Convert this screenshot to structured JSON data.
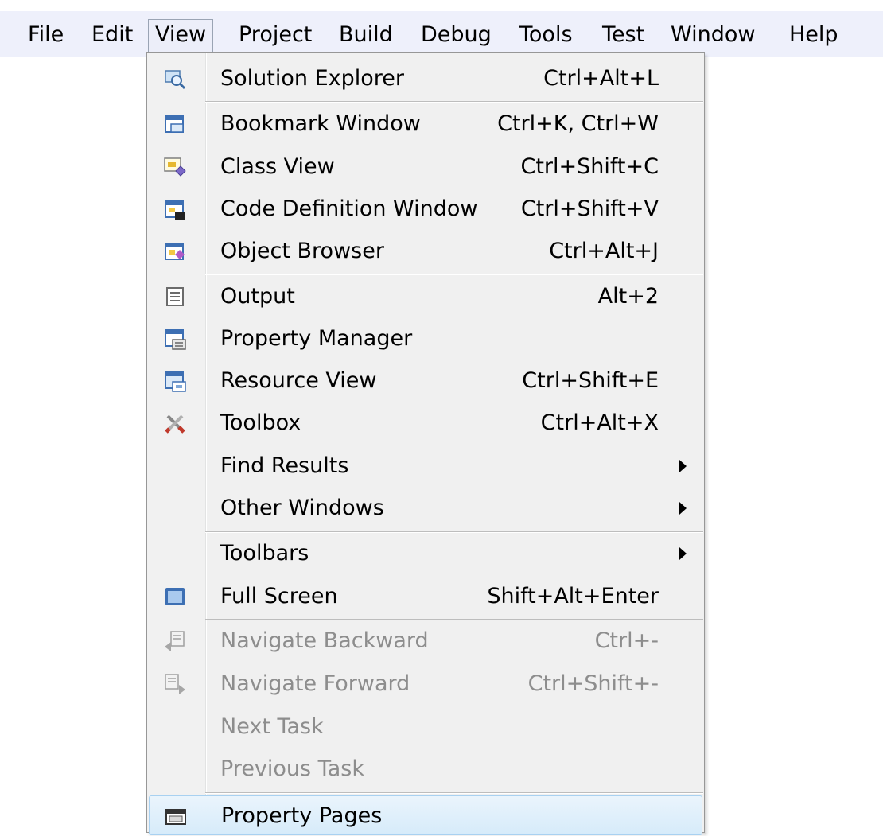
{
  "menubar": {
    "items": [
      {
        "label": "File"
      },
      {
        "label": "Edit"
      },
      {
        "label": "View"
      },
      {
        "label": "Project"
      },
      {
        "label": "Build"
      },
      {
        "label": "Debug"
      },
      {
        "label": "Tools"
      },
      {
        "label": "Test"
      },
      {
        "label": "Window"
      },
      {
        "label": "Help"
      }
    ]
  },
  "view_menu": {
    "items": [
      {
        "label": "Solution Explorer",
        "shortcut": "Ctrl+Alt+L",
        "icon": "solution-explorer-icon"
      },
      {
        "label": "Bookmark Window",
        "shortcut": "Ctrl+K, Ctrl+W",
        "icon": "bookmark-window-icon"
      },
      {
        "label": "Class View",
        "shortcut": "Ctrl+Shift+C",
        "icon": "class-view-icon"
      },
      {
        "label": "Code Definition Window",
        "shortcut": "Ctrl+Shift+V",
        "icon": "code-definition-icon"
      },
      {
        "label": "Object Browser",
        "shortcut": "Ctrl+Alt+J",
        "icon": "object-browser-icon"
      },
      {
        "label": "Output",
        "shortcut": "Alt+2",
        "icon": "output-icon"
      },
      {
        "label": "Property Manager",
        "shortcut": "",
        "icon": "property-manager-icon"
      },
      {
        "label": "Resource View",
        "shortcut": "Ctrl+Shift+E",
        "icon": "resource-view-icon"
      },
      {
        "label": "Toolbox",
        "shortcut": "Ctrl+Alt+X",
        "icon": "toolbox-icon"
      },
      {
        "label": "Find Results",
        "shortcut": "",
        "icon": ""
      },
      {
        "label": "Other Windows",
        "shortcut": "",
        "icon": ""
      },
      {
        "label": "Toolbars",
        "shortcut": "",
        "icon": ""
      },
      {
        "label": "Full Screen",
        "shortcut": "Shift+Alt+Enter",
        "icon": "full-screen-icon"
      },
      {
        "label": "Navigate Backward",
        "shortcut": "Ctrl+-",
        "icon": "navigate-backward-icon"
      },
      {
        "label": "Navigate Forward",
        "shortcut": "Ctrl+Shift+-",
        "icon": "navigate-forward-icon"
      },
      {
        "label": "Next Task",
        "shortcut": "",
        "icon": ""
      },
      {
        "label": "Previous Task",
        "shortcut": "",
        "icon": ""
      },
      {
        "label": "Property Pages",
        "shortcut": "",
        "icon": "property-pages-icon"
      }
    ]
  },
  "colors": {
    "menubar_bg": "#eef0fb",
    "menu_bg": "#f0f0f0",
    "highlight": "#d6ebfa",
    "disabled_text": "#8d8d8d"
  }
}
